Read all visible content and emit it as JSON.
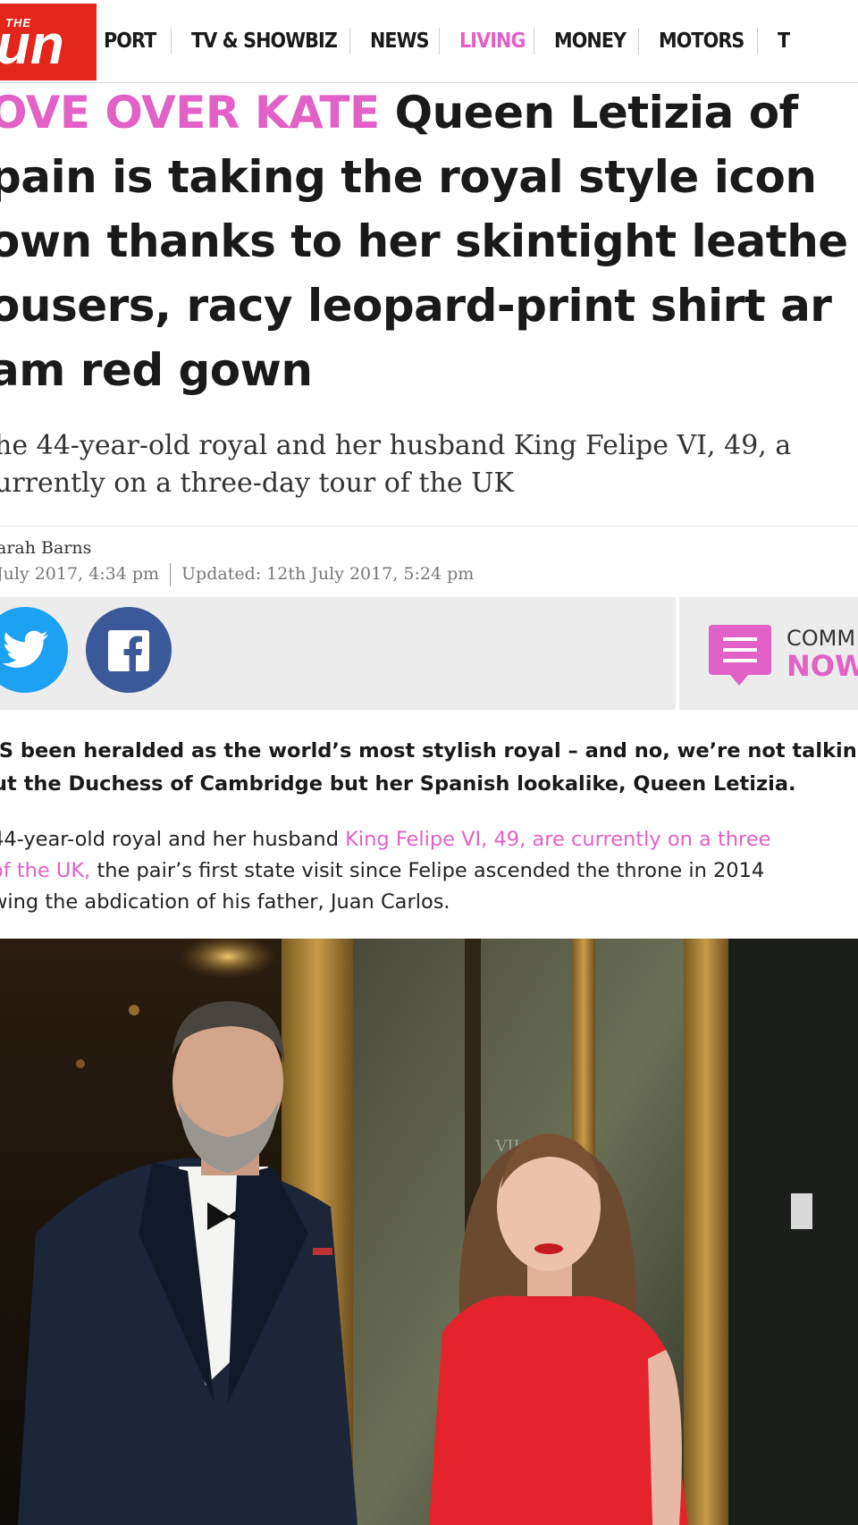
{
  "nav": {
    "logo_top": "THE",
    "logo_main": "un",
    "items": [
      {
        "label": "PORT",
        "active": false
      },
      {
        "label": "TV & SHOWBIZ",
        "active": false
      },
      {
        "label": "NEWS",
        "active": false
      },
      {
        "label": "LIVING",
        "active": true
      },
      {
        "label": "MONEY",
        "active": false
      },
      {
        "label": "MOTORS",
        "active": false
      },
      {
        "label": "T",
        "active": false
      }
    ]
  },
  "article": {
    "kicker": "OVE OVER KATE",
    "headline_lines": [
      " Queen Letizia of",
      "pain is taking the royal style icon",
      "own thanks to her skintight leathe",
      "ousers, racy leopard-print shirt ar",
      "am red gown"
    ],
    "subhead_lines": [
      "he 44-year-old royal and her husband King Felipe VI, 49, a",
      "urrently on a three-day tour of the UK"
    ],
    "author": "arah Barns",
    "published": "July 2017, 4:34 pm",
    "updated": "Updated: 12th July 2017, 5:24 pm",
    "comments_label": "COMM",
    "comments_action": "NOW",
    "lead_lines": [
      "'S been heralded as the world’s most stylish royal – and no, we’re not talkin",
      "ut the Duchess of Cambridge but her Spanish lookalike, Queen Letizia."
    ],
    "para_line1_prefix": "44-year-old royal and her husband ",
    "para_line1_link": "King Felipe VI, 49, are currently on a three",
    "para_line2_link": "of the UK,",
    "para_line2_rest": " the pair’s first state visit since Felipe ascended the throne in 2014",
    "para_line3": "wing the abdication of his father, Juan Carlos.",
    "photo_sign": "VII"
  },
  "colors": {
    "brand_red": "#e2261c",
    "living_pink": "#e261c6",
    "twitter_blue": "#1da1f2",
    "facebook_blue": "#3b5998",
    "share_bar_grey": "#ececec"
  },
  "icons": [
    "twitter-icon",
    "facebook-icon",
    "comments-icon"
  ]
}
